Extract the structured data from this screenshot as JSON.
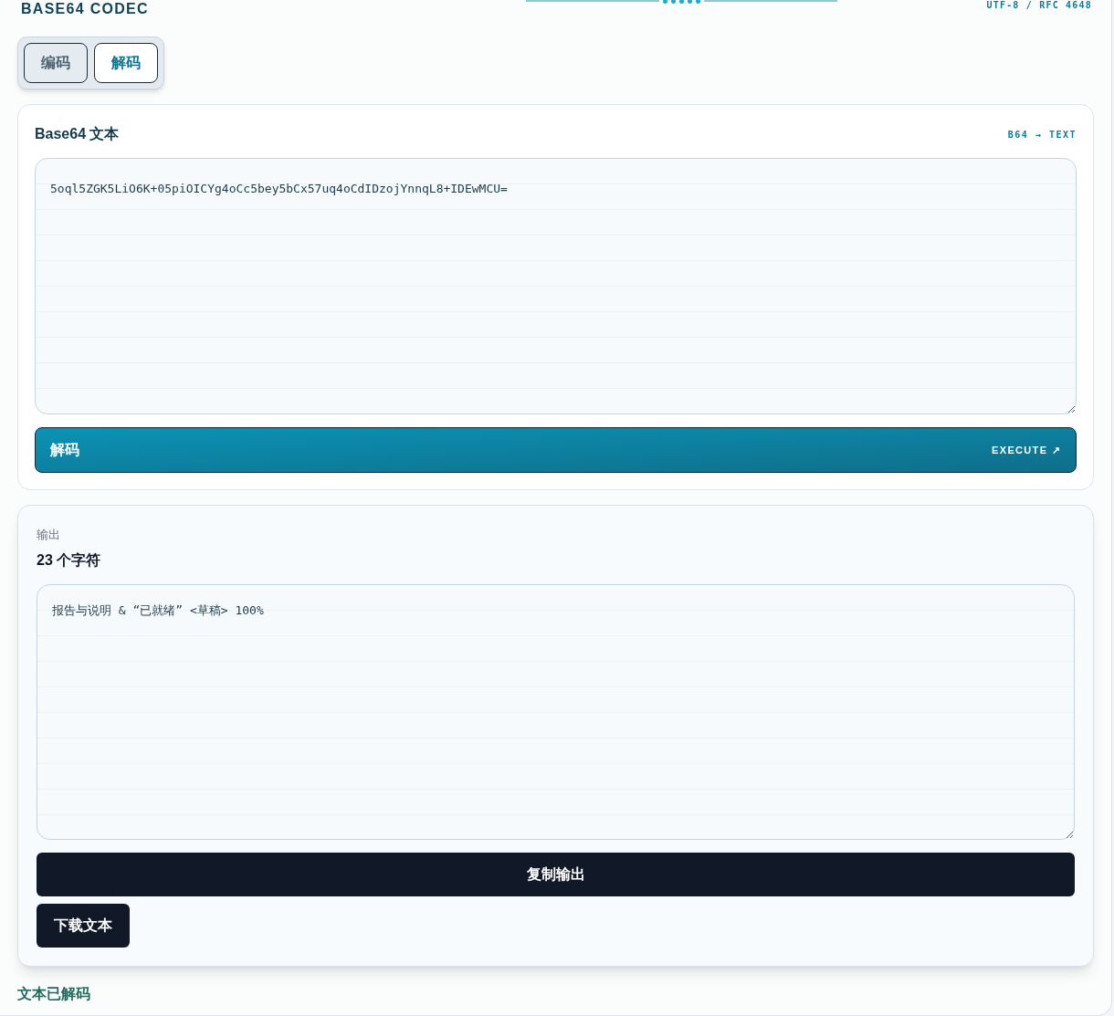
{
  "header": {
    "title": "BASE64 CODEC",
    "standard": "UTF-8 / RFC 4648"
  },
  "mode_tabs": [
    {
      "label": "编码",
      "selected": false
    },
    {
      "label": "解码",
      "selected": true
    }
  ],
  "input_panel": {
    "title": "Base64 文本",
    "direction": "B64 → TEXT",
    "value": "5oql5ZGK5LiO6K+05piOICYg4oCc5bey5bCx57uq4oCdIDzojYnnqL8+IDEwMCU=",
    "action": {
      "label": "解码",
      "hint": "EXECUTE ↗"
    }
  },
  "output_panel": {
    "label": "输出",
    "count": "23 个字符",
    "value": "报告与说明 & “已就绪” <草稿> 100%",
    "buttons": [
      {
        "label": "复制输出",
        "kind": "wide"
      },
      {
        "label": "下载文本",
        "kind": "compact"
      }
    ]
  },
  "status": "文本已解码"
}
